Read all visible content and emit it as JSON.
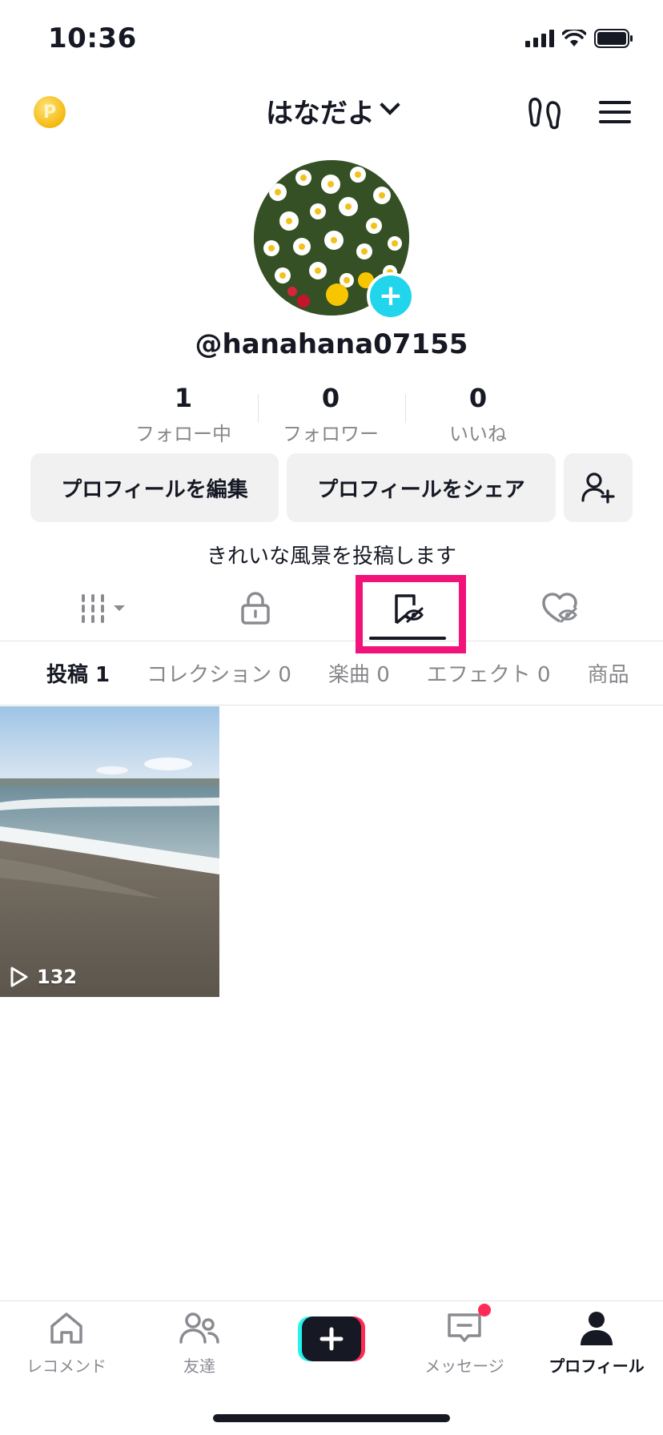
{
  "status_bar": {
    "time": "10:36"
  },
  "header": {
    "username": "はなだよ"
  },
  "profile": {
    "handle": "@hanahana07155",
    "stats": [
      {
        "count": "1",
        "label": "フォロー中"
      },
      {
        "count": "0",
        "label": "フォロワー"
      },
      {
        "count": "0",
        "label": "いいね"
      }
    ],
    "buttons": {
      "edit": "プロフィールを編集",
      "share": "プロフィールをシェア"
    },
    "bio": "きれいな風景を投稿します"
  },
  "subtabs": [
    {
      "label": "投稿 1",
      "active": true
    },
    {
      "label": "コレクション 0",
      "active": false
    },
    {
      "label": "楽曲 0",
      "active": false
    },
    {
      "label": "エフェクト 0",
      "active": false
    },
    {
      "label": "商品",
      "active": false
    }
  ],
  "videos": [
    {
      "views": "132"
    }
  ],
  "bottom_nav": [
    {
      "label": "レコメンド",
      "icon": "home-icon"
    },
    {
      "label": "友達",
      "icon": "friends-icon"
    },
    {
      "label": "",
      "icon": "create-icon"
    },
    {
      "label": "メッセージ",
      "icon": "message-icon"
    },
    {
      "label": "プロフィール",
      "icon": "profile-icon"
    }
  ],
  "colors": {
    "accent_cyan": "#20d5ec",
    "highlight_pink": "#f1127a",
    "notification_red": "#fe2c55"
  }
}
